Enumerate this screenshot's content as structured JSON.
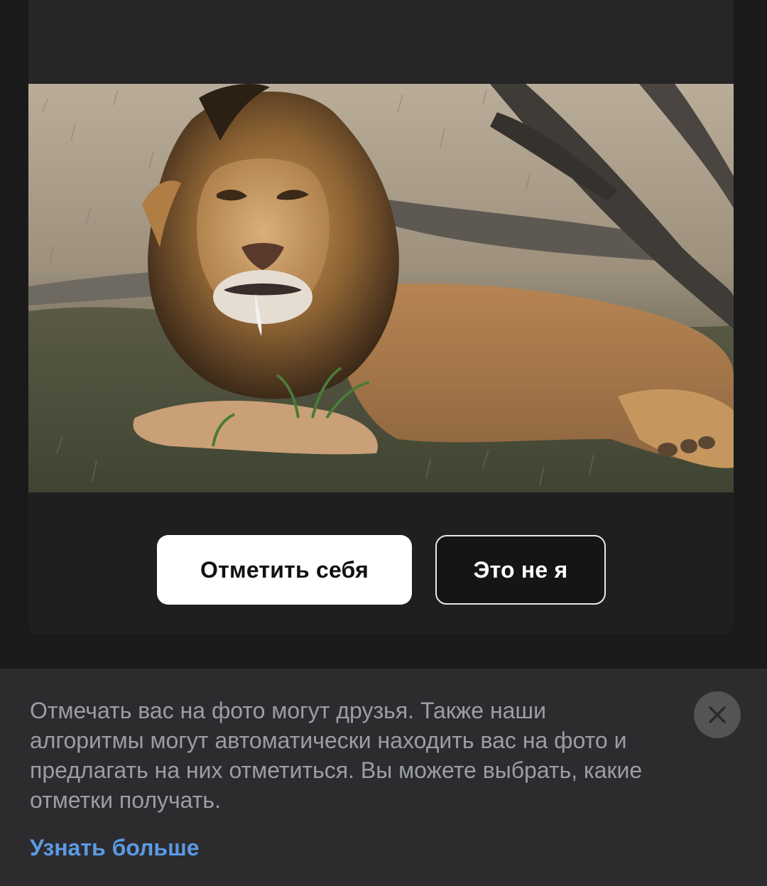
{
  "tag_prompt": {
    "photo": {
      "subject_icon": "lion-photo"
    },
    "buttons": {
      "tag_self": "Отметить себя",
      "not_me": "Это не я"
    }
  },
  "info_banner": {
    "text": "Отмечать вас на фото могут друзья. Также наши алгоритмы могут автоматически находить вас на фото и предлагать на них отметиться. Вы можете выбрать, какие отметки получать.",
    "link_label": "Узнать больше",
    "close_icon": "close-icon"
  },
  "colors": {
    "background": "#1a1a1b",
    "card": "#222224",
    "banner": "#2c2c2e",
    "link": "#5b9ae5",
    "primary_button": "#ffffff",
    "muted_text": "#9b9ea3"
  }
}
